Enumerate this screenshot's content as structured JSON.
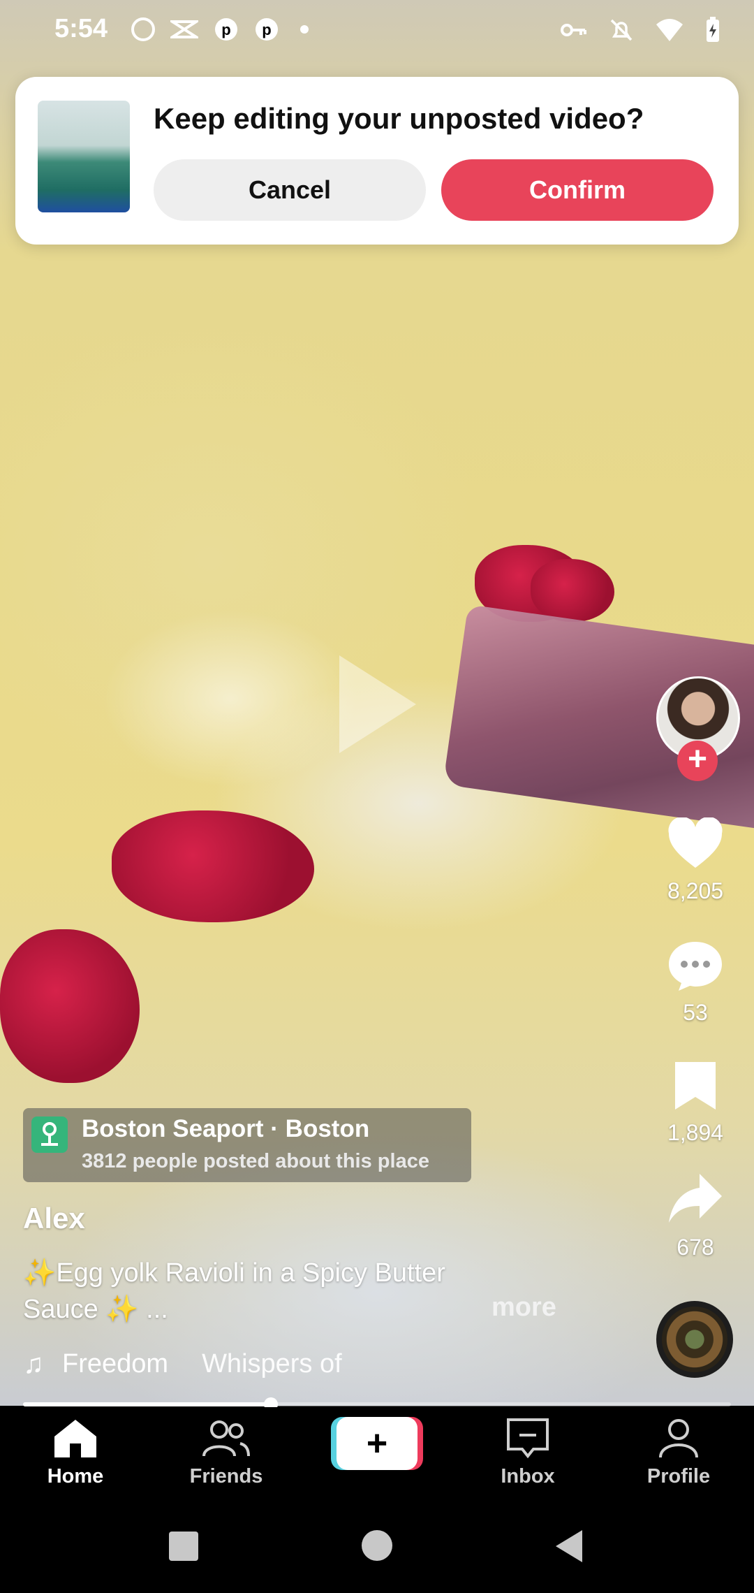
{
  "status_bar": {
    "time": "5:54",
    "left_icons": [
      "record-icon",
      "capcut-icon",
      "pinterest-icon",
      "pinterest-icon",
      "dot-icon"
    ],
    "right_icons": [
      "vpn-key-icon",
      "bell-off-icon",
      "wifi-icon",
      "battery-charging-icon"
    ]
  },
  "dialog": {
    "title": "Keep editing your unposted video?",
    "cancel_label": "Cancel",
    "confirm_label": "Confirm",
    "confirm_color": "#e8445a"
  },
  "actions": {
    "likes": "8,205",
    "comments": "53",
    "saves": "1,894",
    "shares": "678"
  },
  "location": {
    "title": "Boston Seaport · Boston",
    "subtitle": "3812 people posted about this place"
  },
  "post": {
    "author": "Alex",
    "caption": "✨Egg yolk Ravioli in a Spicy Butter Sauce ✨ ...",
    "more_label": "more",
    "music_track_1": "Freedom",
    "music_track_2": "Whispers of",
    "progress": 0.35
  },
  "nav": {
    "home": "Home",
    "friends": "Friends",
    "inbox": "Inbox",
    "profile": "Profile"
  }
}
